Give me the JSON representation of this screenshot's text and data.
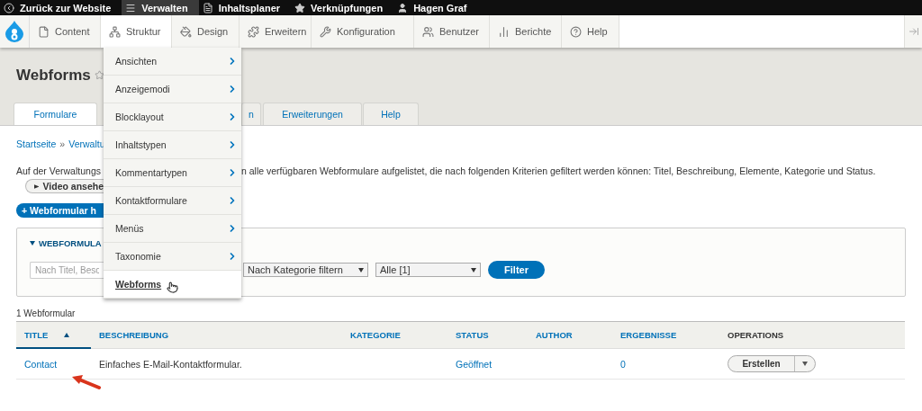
{
  "admin_toolbar": {
    "items": [
      {
        "kind": "back",
        "label": "Zurück zur Website",
        "selected": false
      },
      {
        "kind": "menu",
        "label": "Verwalten",
        "selected": true
      },
      {
        "kind": "document",
        "label": "Inhaltsplaner",
        "selected": false
      },
      {
        "kind": "star",
        "label": "Verknüpfungen",
        "selected": false
      },
      {
        "kind": "user",
        "label": "Hagen Graf",
        "selected": false
      }
    ]
  },
  "menu_bar": {
    "items": [
      {
        "kind": "content",
        "label": "Content",
        "selected": false
      },
      {
        "kind": "structure",
        "label": "Struktur",
        "selected": true
      },
      {
        "kind": "design",
        "label": "Design",
        "selected": false
      },
      {
        "kind": "extend",
        "label": "Erweitern",
        "selected": false
      },
      {
        "kind": "config",
        "label": "Konfiguration",
        "selected": false
      },
      {
        "kind": "people",
        "label": "Benutzer",
        "selected": false
      },
      {
        "kind": "reports",
        "label": "Berichte",
        "selected": false
      },
      {
        "kind": "help",
        "label": "Help",
        "selected": false
      }
    ]
  },
  "structure_menu": {
    "items": [
      {
        "label": "Ansichten",
        "has_submenu": true,
        "selected": false
      },
      {
        "label": "Anzeigemodi",
        "has_submenu": true,
        "selected": false
      },
      {
        "label": "Blocklayout",
        "has_submenu": true,
        "selected": false
      },
      {
        "label": "Inhaltstypen",
        "has_submenu": true,
        "selected": false
      },
      {
        "label": "Kommentartypen",
        "has_submenu": true,
        "selected": false
      },
      {
        "label": "Kontaktformulare",
        "has_submenu": true,
        "selected": false
      },
      {
        "label": "Menüs",
        "has_submenu": true,
        "selected": false
      },
      {
        "label": "Taxonomie",
        "has_submenu": true,
        "selected": false
      },
      {
        "label": "Webforms",
        "has_submenu": false,
        "selected": true
      }
    ]
  },
  "page": {
    "title": "Webforms",
    "tabs": [
      {
        "label": "Formulare",
        "selected": true
      },
      {
        "label": "n",
        "selected": false
      },
      {
        "label": "Erweiterungen",
        "selected": false
      },
      {
        "label": "Help",
        "selected": false
      }
    ],
    "breadcrumb": {
      "items": [
        "Startseite"
      ],
      "separator": "»",
      "cut": "Verwaltu"
    },
    "description": [
      "Auf der Verwaltungs",
      "n alle verfügbaren Webformulare aufgelistet, die nach folgenden Kriterien gefiltert werden können: Titel, Beschreibung, Elemente, Kategorie und Status."
    ],
    "video_button": "Video ansehe",
    "add_button": "+ Webformular h",
    "filter": {
      "legend": "WEBFORMULA",
      "expanded": true,
      "search_placeholder": "Nach Titel, Besc",
      "category_select": "Nach Kategorie filtern",
      "state_select": "Alle [1]",
      "button": "Filter"
    },
    "count": "1 Webformular",
    "table": {
      "columns": [
        {
          "label": "TITLE",
          "sortable": true,
          "sorted": true
        },
        {
          "label": "BESCHREIBUNG",
          "sortable": true,
          "sorted": false
        },
        {
          "label": "KATEGORIE",
          "sortable": true,
          "sorted": false
        },
        {
          "label": "STATUS",
          "sortable": true,
          "sorted": false
        },
        {
          "label": "AUTHOR",
          "sortable": true,
          "sorted": false
        },
        {
          "label": "ERGEBNISSE",
          "sortable": true,
          "sorted": false
        },
        {
          "label": "OPERATIONS",
          "sortable": false,
          "sorted": false
        }
      ],
      "rows": [
        {
          "title": "Contact",
          "description": "Einfaches E-Mail-Kontaktformular.",
          "status": "Geöffnet",
          "results": "0",
          "operation": "Erstellen"
        }
      ]
    }
  }
}
